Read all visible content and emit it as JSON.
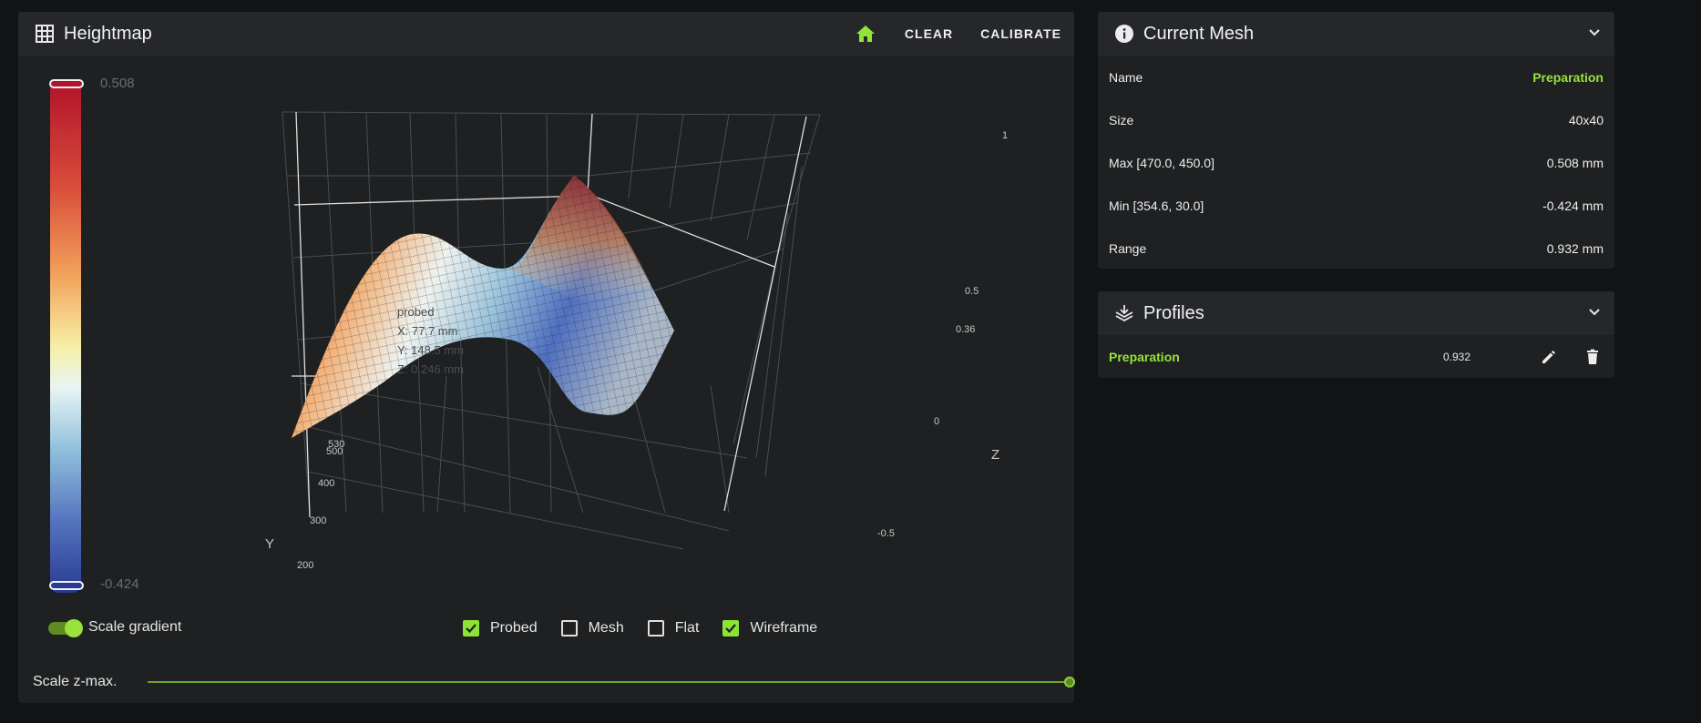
{
  "heightmap": {
    "title": "Heightmap",
    "actions": {
      "clear": "CLEAR",
      "calibrate": "CALIBRATE"
    },
    "scale": {
      "max": "0.508",
      "min": "-0.424"
    },
    "plot": {
      "z_ticks": [
        "1",
        "0.5",
        "0.36",
        "0",
        "-0.5"
      ],
      "y_ticks": [
        "530",
        "500",
        "400",
        "300",
        "200"
      ],
      "z_axis_label": "Z",
      "y_axis_label": "Y",
      "tooltip": {
        "title": "probed",
        "x": "X: 77.7 mm",
        "y": "Y: 148.5 mm",
        "z": "Z: 0.246 mm"
      }
    },
    "scale_gradient": {
      "label": "Scale gradient",
      "enabled": true
    },
    "checkboxes": [
      {
        "label": "Probed",
        "checked": true
      },
      {
        "label": "Mesh",
        "checked": false
      },
      {
        "label": "Flat",
        "checked": false
      },
      {
        "label": "Wireframe",
        "checked": true
      }
    ],
    "scale_zmax": {
      "label": "Scale z-max.",
      "value": 1.0
    }
  },
  "current_mesh": {
    "title": "Current Mesh",
    "rows": [
      {
        "label": "Name",
        "value": "Preparation"
      },
      {
        "label": "Size",
        "value": "40x40"
      },
      {
        "label": "Max [470.0, 450.0]",
        "value": "0.508 mm"
      },
      {
        "label": "Min [354.6, 30.0]",
        "value": "-0.424 mm"
      },
      {
        "label": "Range",
        "value": "0.932 mm"
      }
    ]
  },
  "profiles": {
    "title": "Profiles",
    "items": [
      {
        "name": "Preparation",
        "range": "0.932"
      }
    ]
  },
  "colors": {
    "accent": "#96e23a",
    "card": "#1e2022",
    "header": "#25272a",
    "background": "#121314"
  }
}
